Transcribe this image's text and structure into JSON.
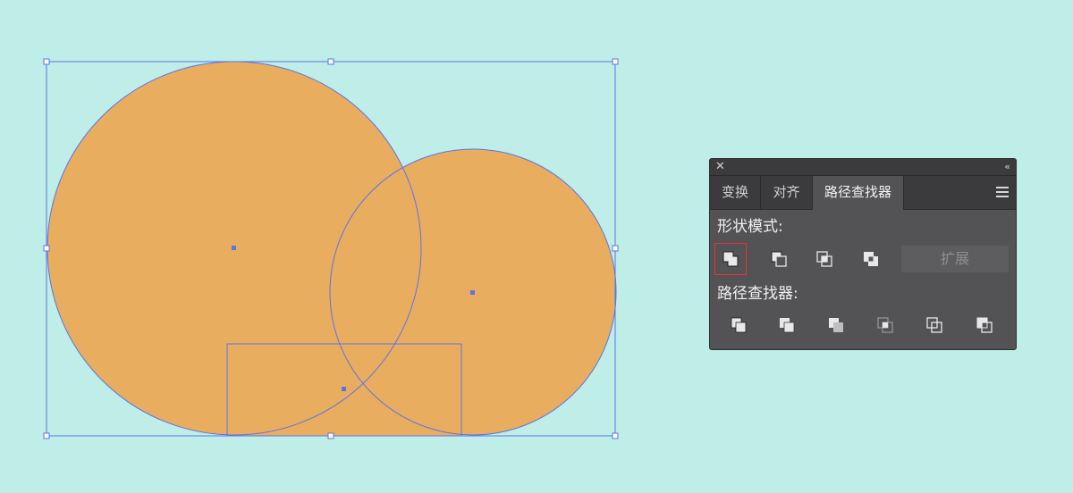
{
  "panel": {
    "close_icon": "close-x-icon",
    "collapse_glyph": "‹‹",
    "tabs": [
      {
        "label": "变换"
      },
      {
        "label": "对齐"
      },
      {
        "label": "路径查找器",
        "active": true
      }
    ],
    "shape_modes": {
      "label": "形状模式:",
      "buttons": [
        {
          "name": "unite-icon",
          "selected": true
        },
        {
          "name": "minus-front-icon"
        },
        {
          "name": "intersect-icon"
        },
        {
          "name": "exclude-icon"
        }
      ],
      "expand_label": "扩展"
    },
    "pathfinders": {
      "label": "路径查找器:",
      "buttons": [
        {
          "name": "divide-icon"
        },
        {
          "name": "trim-icon"
        },
        {
          "name": "merge-icon"
        },
        {
          "name": "crop-icon"
        },
        {
          "name": "outline-icon"
        },
        {
          "name": "minus-back-icon"
        }
      ]
    }
  },
  "colors": {
    "canvas_background": "#bfede7",
    "shape_fill": "#e9ad5f",
    "selection_blue": "#5b73e8",
    "panel_background": "#535254",
    "selected_button_border": "#e8333a"
  }
}
